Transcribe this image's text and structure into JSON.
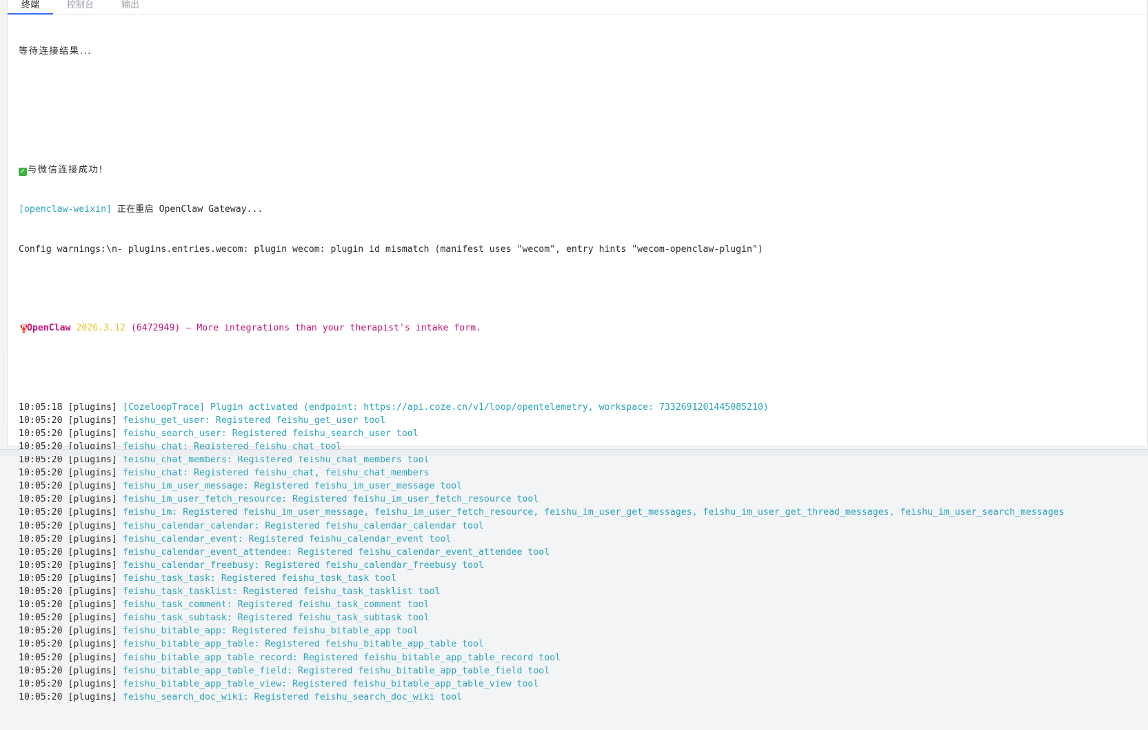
{
  "tabs": [
    {
      "label": "终端",
      "active": true
    },
    {
      "label": "控制台",
      "active": false
    },
    {
      "label": "输出",
      "active": false
    }
  ],
  "terminal": {
    "waiting": "等待连接结果...",
    "success": "与微信连接成功!",
    "restart_tag": "[openclaw-weixin]",
    "restart_text": " 正在重启 OpenClaw Gateway...",
    "config_warning": "Config warnings:\\n- plugins.entries.wecom: plugin wecom: plugin id mismatch (manifest uses \"wecom\", entry hints \"wecom-openclaw-plugin\")",
    "banner": {
      "name": "OpenClaw",
      "version": "2026.3.12",
      "build": "(6472949)",
      "tagline": " — More integrations than your therapist's intake form."
    },
    "logs": [
      {
        "time": "10:05:18",
        "tag": "[plugins]",
        "msg": "[CozeloopTrace] Plugin activated (endpoint: https://api.coze.cn/v1/loop/opentelemetry, workspace: 7332691201445085210)"
      },
      {
        "time": "10:05:20",
        "tag": "[plugins]",
        "msg": "feishu_get_user: Registered feishu_get_user tool"
      },
      {
        "time": "10:05:20",
        "tag": "[plugins]",
        "msg": "feishu_search_user: Registered feishu_search_user tool"
      },
      {
        "time": "10:05:20",
        "tag": "[plugins]",
        "msg": "feishu_chat: Registered feishu_chat tool"
      },
      {
        "time": "10:05:20",
        "tag": "[plugins]",
        "msg": "feishu_chat_members: Registered feishu_chat_members tool"
      },
      {
        "time": "10:05:20",
        "tag": "[plugins]",
        "msg": "feishu_chat: Registered feishu_chat, feishu_chat_members"
      },
      {
        "time": "10:05:20",
        "tag": "[plugins]",
        "msg": "feishu_im_user_message: Registered feishu_im_user_message tool"
      },
      {
        "time": "10:05:20",
        "tag": "[plugins]",
        "msg": "feishu_im_user_fetch_resource: Registered feishu_im_user_fetch_resource tool"
      },
      {
        "time": "10:05:20",
        "tag": "[plugins]",
        "msg": "feishu_im: Registered feishu_im_user_message, feishu_im_user_fetch_resource, feishu_im_user_get_messages, feishu_im_user_get_thread_messages, feishu_im_user_search_messages"
      },
      {
        "time": "10:05:20",
        "tag": "[plugins]",
        "msg": "feishu_calendar_calendar: Registered feishu_calendar_calendar tool"
      },
      {
        "time": "10:05:20",
        "tag": "[plugins]",
        "msg": "feishu_calendar_event: Registered feishu_calendar_event tool"
      },
      {
        "time": "10:05:20",
        "tag": "[plugins]",
        "msg": "feishu_calendar_event_attendee: Registered feishu_calendar_event_attendee tool"
      },
      {
        "time": "10:05:20",
        "tag": "[plugins]",
        "msg": "feishu_calendar_freebusy: Registered feishu_calendar_freebusy tool"
      },
      {
        "time": "10:05:20",
        "tag": "[plugins]",
        "msg": "feishu_task_task: Registered feishu_task_task tool"
      },
      {
        "time": "10:05:20",
        "tag": "[plugins]",
        "msg": "feishu_task_tasklist: Registered feishu_task_tasklist tool"
      },
      {
        "time": "10:05:20",
        "tag": "[plugins]",
        "msg": "feishu_task_comment: Registered feishu_task_comment tool"
      },
      {
        "time": "10:05:20",
        "tag": "[plugins]",
        "msg": "feishu_task_subtask: Registered feishu_task_subtask tool"
      },
      {
        "time": "10:05:20",
        "tag": "[plugins]",
        "msg": "feishu_bitable_app: Registered feishu_bitable_app tool"
      },
      {
        "time": "10:05:20",
        "tag": "[plugins]",
        "msg": "feishu_bitable_app_table: Registered feishu_bitable_app_table tool"
      },
      {
        "time": "10:05:20",
        "tag": "[plugins]",
        "msg": "feishu_bitable_app_table_record: Registered feishu_bitable_app_table_record tool"
      },
      {
        "time": "10:05:20",
        "tag": "[plugins]",
        "msg": "feishu_bitable_app_table_field: Registered feishu_bitable_app_table_field tool"
      },
      {
        "time": "10:05:20",
        "tag": "[plugins]",
        "msg": "feishu_bitable_app_table_view: Registered feishu_bitable_app_table_view tool"
      },
      {
        "time": "10:05:20",
        "tag": "[plugins]",
        "msg": "feishu_search_doc_wiki: Registered feishu_search_doc_wiki tool"
      }
    ]
  },
  "icons": {
    "success": "check-mark-icon",
    "banner": "lobster-icon"
  },
  "colors": {
    "log_message": "#2aa4bc",
    "banner_name": "#c4157a",
    "banner_version": "#e8c12e",
    "active_tab_underline": "#3a6ff7"
  }
}
